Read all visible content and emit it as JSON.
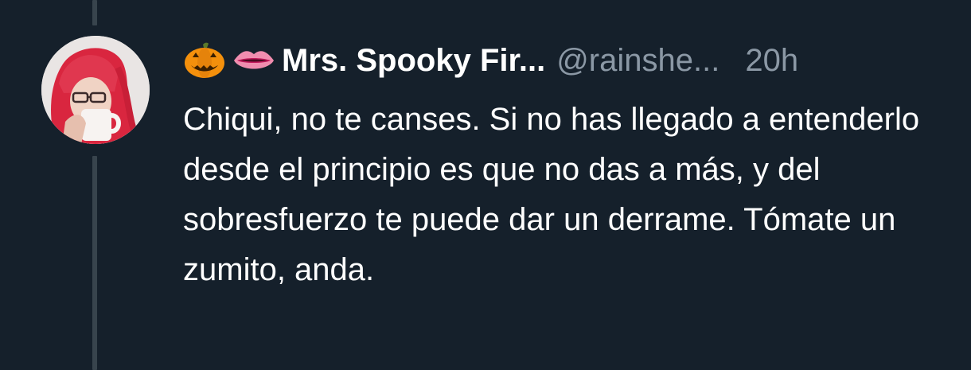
{
  "author": {
    "emojis": [
      "jack-o-lantern",
      "lips"
    ],
    "display_name": "Mrs. Spooky Fir...",
    "handle": "@rainshe...",
    "time": "20h"
  },
  "tweet": {
    "text": "Chiqui, no te canses. Si no has llegado a entenderlo desde el principio es que no das a más, y del sobresfuerzo te puede dar un derrame. Tómate un zumito, anda."
  },
  "colors": {
    "background": "#15202b",
    "thread_line": "#38444d",
    "text_primary": "#ffffff",
    "text_secondary": "#8b98a5"
  }
}
